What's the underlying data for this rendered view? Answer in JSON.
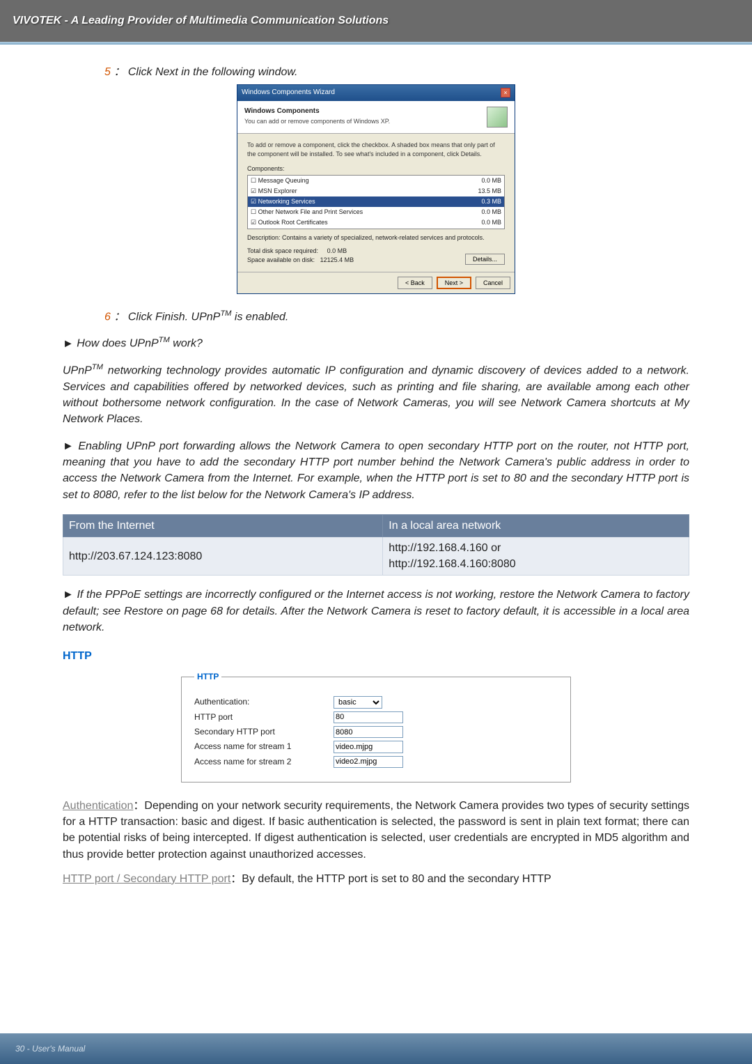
{
  "header": {
    "brand": "VIVOTEK - A Leading Provider of Multimedia Communication Solutions"
  },
  "steps": {
    "s5_num": "5",
    "s5_sep": "：",
    "s5_text_a": "Click Next in the following window.",
    "s6_num": "6",
    "s6_sep": "：",
    "s6_text_a": "Click Finish. UPnP",
    "s6_text_b": " is enabled.",
    "tm": "TM"
  },
  "wizard": {
    "title": "Windows Components Wizard",
    "head_bold": "Windows Components",
    "head_sub": "You can add or remove components of Windows XP.",
    "instr": "To add or remove a component, click the checkbox. A shaded box means that only part of the component will be installed. To see what's included in a component, click Details.",
    "components_label": "Components:",
    "rows": [
      {
        "name": "Message Queuing",
        "size": "0.0 MB",
        "checked": false
      },
      {
        "name": "MSN Explorer",
        "size": "13.5 MB",
        "checked": true
      },
      {
        "name": "Networking Services",
        "size": "0.3 MB",
        "checked": true,
        "selected": true
      },
      {
        "name": "Other Network File and Print Services",
        "size": "0.0 MB",
        "checked": false
      },
      {
        "name": "Outlook Root Certificates",
        "size": "0.0 MB",
        "checked": true
      }
    ],
    "desc": "Description:  Contains a variety of specialized, network-related services and protocols.",
    "disk_req_lbl": "Total disk space required:",
    "disk_req_val": "0.0 MB",
    "disk_avail_lbl": "Space available on disk:",
    "disk_avail_val": "12125.4 MB",
    "btn_details": "Details...",
    "btn_back": "< Back",
    "btn_next": "Next >",
    "btn_cancel": "Cancel"
  },
  "q_work_a": "How does UPnP",
  "q_work_b": " work?",
  "para_upnp_a": "UPnP",
  "para_upnp_b": " networking technology provides automatic IP configuration and dynamic discovery of devices added to a network. Services and capabilities offered by networked devices, such as printing and file sharing, are available among each other without bothersome network configuration. In the case of Network Cameras, you will see Network Camera shortcuts at My Network Places.",
  "para_forward": "Enabling UPnP port forwarding allows the Network Camera to open secondary HTTP port on the router, not HTTP port, meaning that you have to add the secondary HTTP port number behind the Network Camera's public address in order to access the Network Camera from the Internet. For example, when the HTTP port is set to 80 and the secondary HTTP port is set to 8080, refer to the list below for the Network Camera's IP address.",
  "addr_table": {
    "h1": "From the Internet",
    "h2": "In a local area network",
    "c1": "http://203.67.124.123:8080",
    "c2a": "http://192.168.4.160 or",
    "c2b": "http://192.168.4.160:8080"
  },
  "para_pppoe": "If the PPPoE settings are incorrectly configured or the Internet access is not working, restore the Network Camera to factory default; see Restore on page 68 for details. After the Network Camera is reset to factory default, it is accessible in a local area network.",
  "http_title": "HTTP",
  "http_box": {
    "legend": "HTTP",
    "auth_lbl": "Authentication:",
    "auth_val": "basic",
    "port_lbl": "HTTP port",
    "port_val": "80",
    "sec_lbl": "Secondary HTTP port",
    "sec_val": "8080",
    "s1_lbl": "Access name for stream 1",
    "s1_val": "video.mjpg",
    "s2_lbl": "Access name for stream 2",
    "s2_val": "video2.mjpg"
  },
  "auth_para_label": "Authentication",
  "auth_para_sep": "：",
  "auth_para_text": "Depending on your network security requirements, the Network Camera provides two types of security settings for a HTTP transaction: basic and digest. If basic authentication is selected, the password is sent in plain text format; there can be potential risks of being intercepted. If digest authentication is selected, user credentials are encrypted in MD5 algorithm and thus provide better protection against unauthorized accesses.",
  "port_para_label": "HTTP port / Secondary HTTP port",
  "port_para_sep": "：",
  "port_para_text": "By default, the HTTP port is set to 80 and the secondary HTTP",
  "footer": "30 - User's Manual"
}
